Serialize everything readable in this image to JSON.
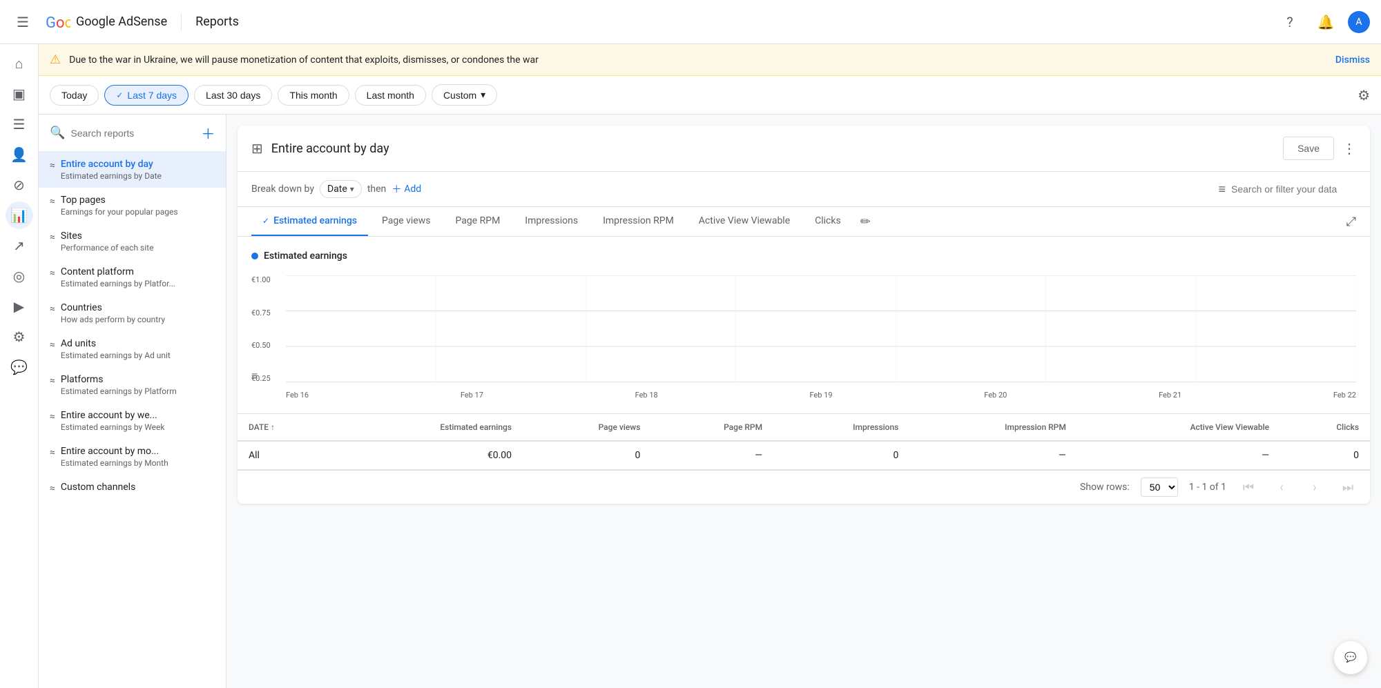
{
  "app": {
    "name": "Google AdSense",
    "page_title": "Reports"
  },
  "banner": {
    "text": "Due to the war in Ukraine, we will pause monetization of content that exploits, dismisses, or condones the war",
    "dismiss_label": "Dismiss"
  },
  "date_filters": [
    {
      "label": "Today",
      "active": false
    },
    {
      "label": "Last 7 days",
      "active": true
    },
    {
      "label": "Last 30 days",
      "active": false
    },
    {
      "label": "This month",
      "active": false
    },
    {
      "label": "Last month",
      "active": false
    },
    {
      "label": "Custom",
      "active": false,
      "has_dropdown": true
    }
  ],
  "search": {
    "placeholder": "Search reports"
  },
  "reports": [
    {
      "title": "Entire account by day",
      "subtitle": "Estimated earnings by Date",
      "active": true
    },
    {
      "title": "Top pages",
      "subtitle": "Earnings for your popular pages",
      "active": false
    },
    {
      "title": "Sites",
      "subtitle": "Performance of each site",
      "active": false
    },
    {
      "title": "Content platform",
      "subtitle": "Estimated earnings by Platfor...",
      "active": false
    },
    {
      "title": "Countries",
      "subtitle": "How ads perform by country",
      "active": false
    },
    {
      "title": "Ad units",
      "subtitle": "Estimated earnings by Ad unit",
      "active": false
    },
    {
      "title": "Platforms",
      "subtitle": "Estimated earnings by Platform",
      "active": false
    },
    {
      "title": "Entire account by we...",
      "subtitle": "Estimated earnings by Week",
      "active": false
    },
    {
      "title": "Entire account by mo...",
      "subtitle": "Estimated earnings by Month",
      "active": false
    },
    {
      "title": "Custom channels",
      "subtitle": "",
      "active": false
    }
  ],
  "report": {
    "title": "Entire account by day",
    "save_label": "Save",
    "breakdown": {
      "label": "Break down by",
      "chip": "Date",
      "then": "then",
      "add": "Add"
    },
    "filter_placeholder": "Search or filter your data"
  },
  "metric_tabs": [
    {
      "label": "Estimated earnings",
      "active": true,
      "has_check": true
    },
    {
      "label": "Page views",
      "active": false
    },
    {
      "label": "Page RPM",
      "active": false
    },
    {
      "label": "Impressions",
      "active": false
    },
    {
      "label": "Impression RPM",
      "active": false
    },
    {
      "label": "Active View Viewable",
      "active": false
    },
    {
      "label": "Clicks",
      "active": false
    }
  ],
  "chart": {
    "title": "Estimated earnings",
    "y_labels": [
      "€1.00",
      "€0.75",
      "€0.50",
      "€0.25"
    ],
    "x_labels": [
      "Feb 16",
      "Feb 17",
      "Feb 18",
      "Feb 19",
      "Feb 20",
      "Feb 21",
      "Feb 22"
    ]
  },
  "table": {
    "columns": [
      {
        "label": "DATE",
        "sortable": true
      },
      {
        "label": "Estimated earnings"
      },
      {
        "label": "Page views"
      },
      {
        "label": "Page RPM"
      },
      {
        "label": "Impressions"
      },
      {
        "label": "Impression RPM"
      },
      {
        "label": "Active View Viewable"
      },
      {
        "label": "Clicks"
      }
    ],
    "rows": [
      {
        "date": "All",
        "estimated_earnings": "€0.00",
        "page_views": "0",
        "page_rpm": "—",
        "impressions": "0",
        "impression_rpm": "—",
        "active_view_viewable": "—",
        "clicks": "0"
      }
    ]
  },
  "pagination": {
    "show_rows_label": "Show rows:",
    "rows_options": [
      "50"
    ],
    "rows_value": "50",
    "info": "1 - 1 of 1"
  },
  "left_nav": {
    "icons": [
      {
        "name": "home-icon",
        "symbol": "⌂"
      },
      {
        "name": "pages-icon",
        "symbol": "▣"
      },
      {
        "name": "content-icon",
        "symbol": "☰"
      },
      {
        "name": "users-icon",
        "symbol": "👤"
      },
      {
        "name": "block-icon",
        "symbol": "⊘"
      },
      {
        "name": "reports-icon",
        "symbol": "📊",
        "active": true
      },
      {
        "name": "trends-icon",
        "symbol": "↗"
      },
      {
        "name": "optimization-icon",
        "symbol": "◎"
      },
      {
        "name": "video-icon",
        "symbol": "▶"
      },
      {
        "name": "settings-icon",
        "symbol": "⚙"
      },
      {
        "name": "feedback-icon",
        "symbol": "💬"
      }
    ]
  }
}
